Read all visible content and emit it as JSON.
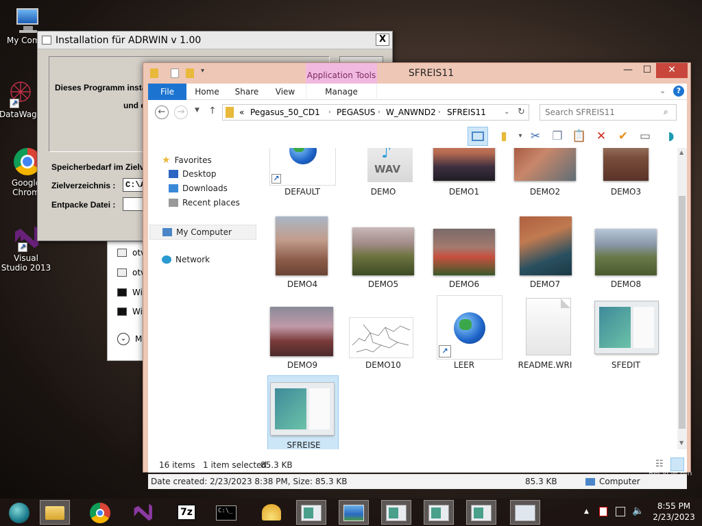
{
  "desktop": {
    "icons": [
      {
        "label": "My Comp",
        "icon": "computer-icon"
      },
      {
        "label": "DataWage",
        "icon": "datawage-icon"
      },
      {
        "label": "Google Chrom",
        "icon": "chrome-icon"
      },
      {
        "label": "Visual Studio 2013",
        "icon": "visual-studio-icon"
      }
    ],
    "recycle_bin_label": "Recycle Bin"
  },
  "installer": {
    "title": "Installation für ADRWIN v 1.00",
    "close": "X",
    "line1": "Dieses Programm instal",
    "line2": "und e",
    "storage_label": "Speicherbedarf im Zielv",
    "target_label": "Zielverzeichnis :",
    "target_value": "C:\\A",
    "unpack_label": "Entpacke Datei :",
    "unpack_value": ""
  },
  "background_list": {
    "rows": [
      "otv",
      "otv",
      "Wi",
      "Wi"
    ],
    "more": "M"
  },
  "explorer": {
    "title": "SFREIS11",
    "application_tools": "Application Tools",
    "window_buttons": {
      "minimize": "—",
      "maximize": "☐",
      "close": "✕"
    },
    "ribbon_tabs": [
      "File",
      "Home",
      "Share",
      "View",
      "Manage"
    ],
    "address": {
      "prefix": "«",
      "parts": [
        "Pegasus_50_CD1",
        "PEGASUS",
        "W_ANWND2",
        "SFREIS11"
      ]
    },
    "search_placeholder": "Search SFREIS11",
    "nav": {
      "favorites": "Favorites",
      "desktop": "Desktop",
      "downloads": "Downloads",
      "recent": "Recent places",
      "my_computer": "My Computer",
      "network": "Network"
    },
    "items": [
      {
        "name": "DEFAULT",
        "kind": "globe-shortcut"
      },
      {
        "name": "DEMO",
        "kind": "wav"
      },
      {
        "name": "DEMO1",
        "kind": "photo"
      },
      {
        "name": "DEMO2",
        "kind": "photo"
      },
      {
        "name": "DEMO3",
        "kind": "photo"
      },
      {
        "name": "DEMO4",
        "kind": "photo"
      },
      {
        "name": "DEMO5",
        "kind": "photo"
      },
      {
        "name": "DEMO6",
        "kind": "photo"
      },
      {
        "name": "DEMO7",
        "kind": "photo"
      },
      {
        "name": "DEMO8",
        "kind": "photo"
      },
      {
        "name": "DEMO9",
        "kind": "photo"
      },
      {
        "name": "DEMO10",
        "kind": "map"
      },
      {
        "name": "LEER",
        "kind": "globe-shortcut"
      },
      {
        "name": "README.WRI",
        "kind": "document"
      },
      {
        "name": "SFEDIT",
        "kind": "app"
      },
      {
        "name": "SFREISE",
        "kind": "app",
        "selected": true
      }
    ],
    "wav_label": "WAV",
    "status": {
      "count": "16 items",
      "selected": "1 item selected",
      "size": "85.3 KB"
    },
    "details": {
      "info": "Date created: 2/23/2023 8:38 PM, Size: 85.3 KB",
      "size": "85.3 KB",
      "location": "Computer"
    }
  },
  "taskbar": {
    "time": "8:55 PM",
    "date": "2/23/2023",
    "buttons": [
      "start-orb-icon",
      "file-explorer-icon",
      "chrome-icon",
      "visual-studio-icon",
      "7zip-icon",
      "cmd-icon",
      "shell-icon",
      "window-icon",
      "photo-viewer-icon",
      "window-icon",
      "window-icon",
      "window-icon",
      "chart-app-icon"
    ]
  },
  "colors": {
    "accent": "#1c74d0",
    "explorer_frame": "#efc7b6",
    "app_tools": "#f2b9e0",
    "selection": "#cde6f7"
  }
}
